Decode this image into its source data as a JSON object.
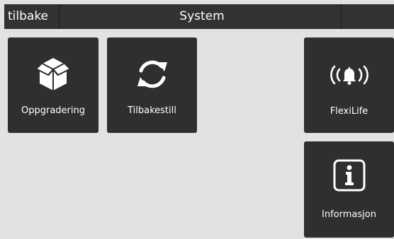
{
  "header": {
    "back_label": "tilbake",
    "title": "System"
  },
  "tiles": [
    {
      "label": "Oppgradering",
      "icon": "box-icon"
    },
    {
      "label": "Tilbakestill",
      "icon": "refresh-icon"
    },
    {
      "label": "FlexiLife",
      "icon": "alarm-bell-icon"
    },
    {
      "label": "Informasjon",
      "icon": "info-icon"
    }
  ],
  "colors": {
    "background": "#e2e2e2",
    "bar": "#323232",
    "tile": "#2f2f2f",
    "text": "#ffffff"
  }
}
